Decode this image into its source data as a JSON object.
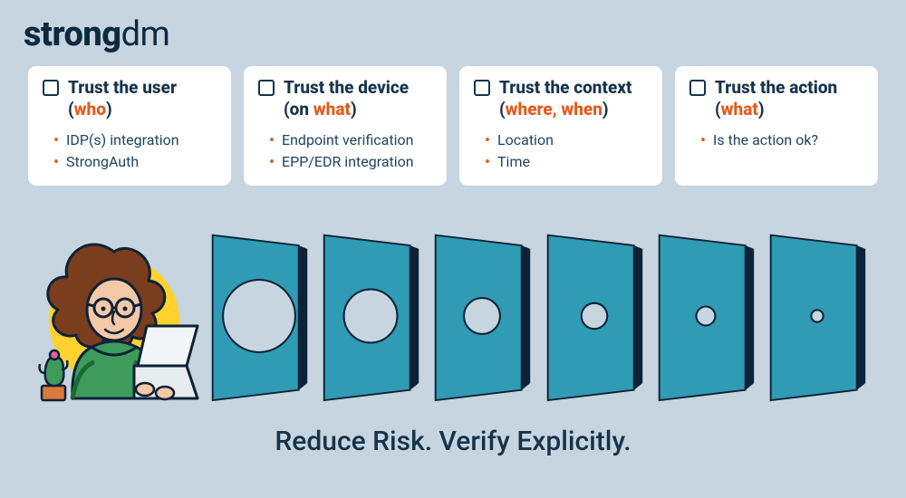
{
  "brand": {
    "strong": "strong",
    "rest": "dm"
  },
  "accent": "#e25a1b",
  "cards": [
    {
      "title": "Trust the user",
      "paren_pre": "(",
      "emph": "who",
      "paren_post": ")",
      "items": [
        "IDP(s) integration",
        "StrongAuth"
      ]
    },
    {
      "title": "Trust the device",
      "paren_pre": "(on ",
      "emph": "what",
      "paren_post": ")",
      "items": [
        "Endpoint verification",
        "EPP/EDR integration"
      ]
    },
    {
      "title": "Trust the context",
      "paren_pre": "(",
      "emph": "where, when",
      "paren_post": ")",
      "items": [
        "Location",
        "Time"
      ]
    },
    {
      "title": "Trust the action",
      "paren_pre": "(",
      "emph": "what",
      "paren_post": ")",
      "items": [
        "Is the action ok?"
      ]
    }
  ],
  "panels": {
    "fill": "#2f9bb5",
    "edge": "#0d2238",
    "hole_radii": [
      42,
      31,
      21,
      15,
      11,
      7
    ]
  },
  "tagline": "Reduce Risk. Verify Explicitly."
}
